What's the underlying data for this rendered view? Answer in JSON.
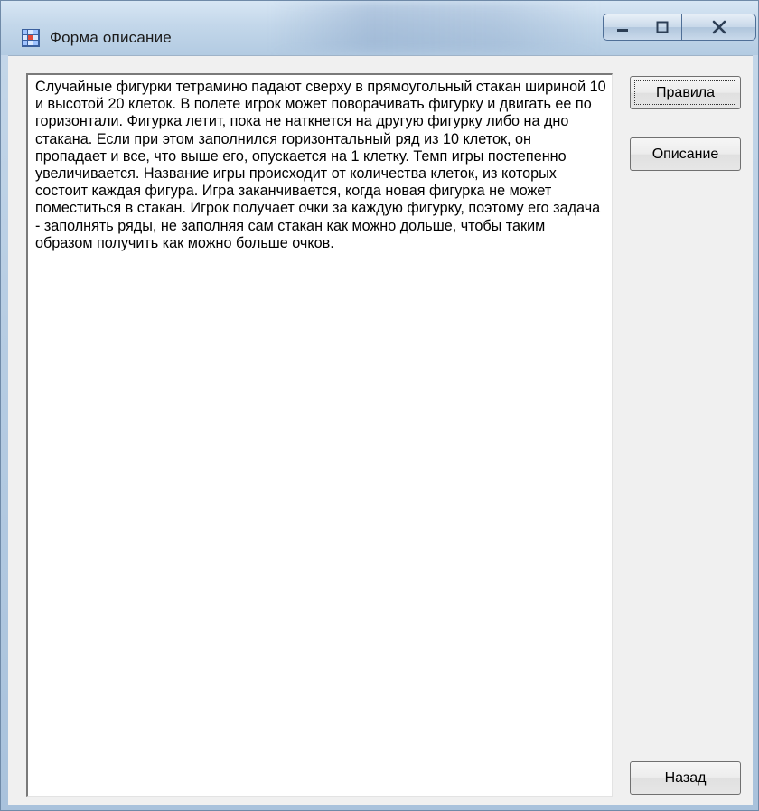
{
  "window": {
    "title": "Форма описание",
    "icon": "app-grid-icon",
    "controls": {
      "minimize_icon": "minimize-icon",
      "maximize_icon": "maximize-icon",
      "close_icon": "close-icon"
    }
  },
  "memo": {
    "text": "Случайные фигурки тетрамино падают сверху в прямоугольный стакан шириной 10 и высотой 20 клеток. В полете игрок может поворачивать фигурку и двигать ее по горизонтали. Фигурка летит, пока не наткнется на другую фигурку либо на дно стакана. Если при этом заполнился горизонтальный ряд из 10 клеток, он пропадает и все, что выше его, опускается на 1 клетку. Темп игры постепенно увеличивается. Название игры происходит от количества клеток, из которых состоит каждая фигура. Игра заканчивается, когда новая фигурка не может поместиться в стакан. Игрок получает очки за каждую фигурку, поэтому его задача - заполнять ряды, не заполняя сам стакан как можно дольше, чтобы таким образом получить как можно больше очков."
  },
  "buttons": {
    "rules": "Правила",
    "description": "Описание",
    "back": "Назад"
  },
  "colors": {
    "titlebar": "#c3d7ea",
    "client_bg": "#f0f0f0",
    "memo_bg": "#ffffff"
  }
}
